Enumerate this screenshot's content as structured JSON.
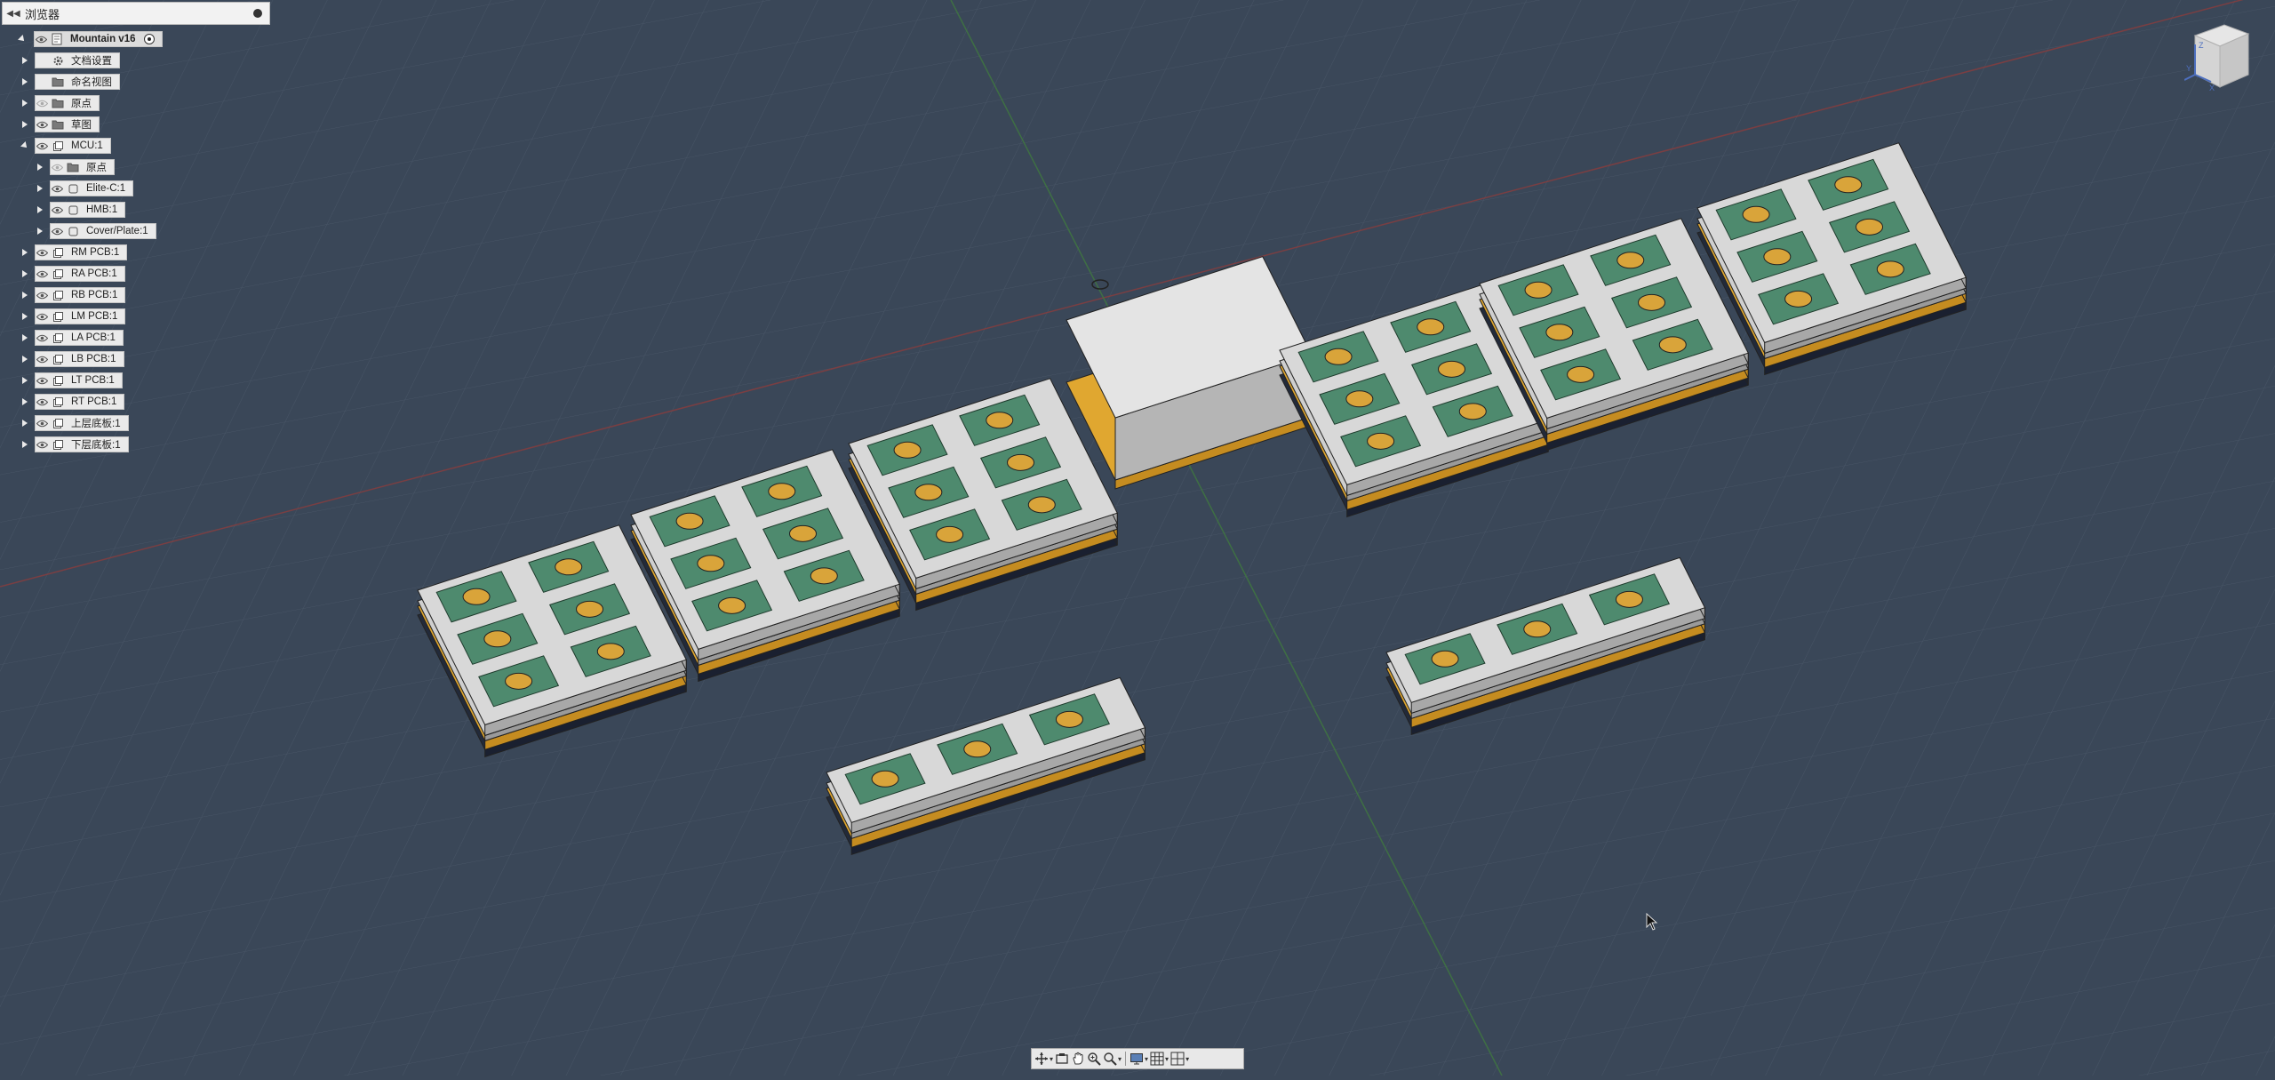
{
  "app": {
    "panel_title": "浏览器"
  },
  "browser": {
    "root": {
      "label": "Mountain v16"
    },
    "items": [
      {
        "label": "文档设置",
        "level": 1,
        "icon": "gear-icon",
        "eye": false,
        "expanded": false
      },
      {
        "label": "命名视图",
        "level": 1,
        "icon": "folder-icon",
        "eye": false,
        "expanded": false
      },
      {
        "label": "原点",
        "level": 1,
        "icon": "folder-icon",
        "eye": true,
        "eye_dim": true,
        "expanded": false
      },
      {
        "label": "草图",
        "level": 1,
        "icon": "folder-icon",
        "eye": true,
        "expanded": false
      },
      {
        "label": "MCU:1",
        "level": 1,
        "icon": "component-icon",
        "eye": true,
        "expanded": true
      },
      {
        "label": "原点",
        "level": 2,
        "icon": "folder-icon",
        "eye": true,
        "eye_dim": true,
        "expanded": false
      },
      {
        "label": "Elite-C:1",
        "level": 2,
        "icon": "body-icon",
        "eye": true,
        "expanded": false
      },
      {
        "label": "HMB:1",
        "level": 2,
        "icon": "body-icon",
        "eye": true,
        "expanded": false
      },
      {
        "label": "Cover/Plate:1",
        "level": 2,
        "icon": "body-icon",
        "eye": true,
        "expanded": false
      },
      {
        "label": "RM PCB:1",
        "level": 1,
        "icon": "component-icon",
        "eye": true,
        "expanded": false
      },
      {
        "label": "RA PCB:1",
        "level": 1,
        "icon": "component-icon",
        "eye": true,
        "expanded": false
      },
      {
        "label": "RB PCB:1",
        "level": 1,
        "icon": "component-icon",
        "eye": true,
        "expanded": false
      },
      {
        "label": "LM PCB:1",
        "level": 1,
        "icon": "component-icon",
        "eye": true,
        "expanded": false
      },
      {
        "label": "LA PCB:1",
        "level": 1,
        "icon": "component-icon",
        "eye": true,
        "expanded": false
      },
      {
        "label": "LB PCB:1",
        "level": 1,
        "icon": "component-icon",
        "eye": true,
        "expanded": false
      },
      {
        "label": "LT PCB:1",
        "level": 1,
        "icon": "component-icon",
        "eye": true,
        "expanded": false
      },
      {
        "label": "RT PCB:1",
        "level": 1,
        "icon": "component-icon",
        "eye": true,
        "expanded": false
      },
      {
        "label": "上层底板:1",
        "level": 1,
        "icon": "component-icon",
        "eye": true,
        "expanded": false
      },
      {
        "label": "下层底板:1",
        "level": 1,
        "icon": "component-icon",
        "eye": true,
        "expanded": false
      }
    ]
  },
  "viewcube": {
    "axis_x": "X",
    "axis_y": "Y",
    "axis_z": "Z"
  },
  "toolbar": {
    "buttons": [
      {
        "name": "orbit-icon"
      },
      {
        "name": "look-at-icon"
      },
      {
        "name": "pan-icon"
      },
      {
        "name": "zoom-icon"
      },
      {
        "name": "fit-icon"
      },
      {
        "name": "display-settings-icon"
      },
      {
        "name": "grid-icon"
      },
      {
        "name": "viewports-icon"
      }
    ]
  },
  "colors": {
    "background": "#3a4758",
    "grid_line": "#4a5768",
    "plate": "#d8d8d8",
    "pcb": "#4e8a6e",
    "base": "#e0a730",
    "axis_red": "#a04040",
    "axis_green": "#3f7a3f"
  }
}
